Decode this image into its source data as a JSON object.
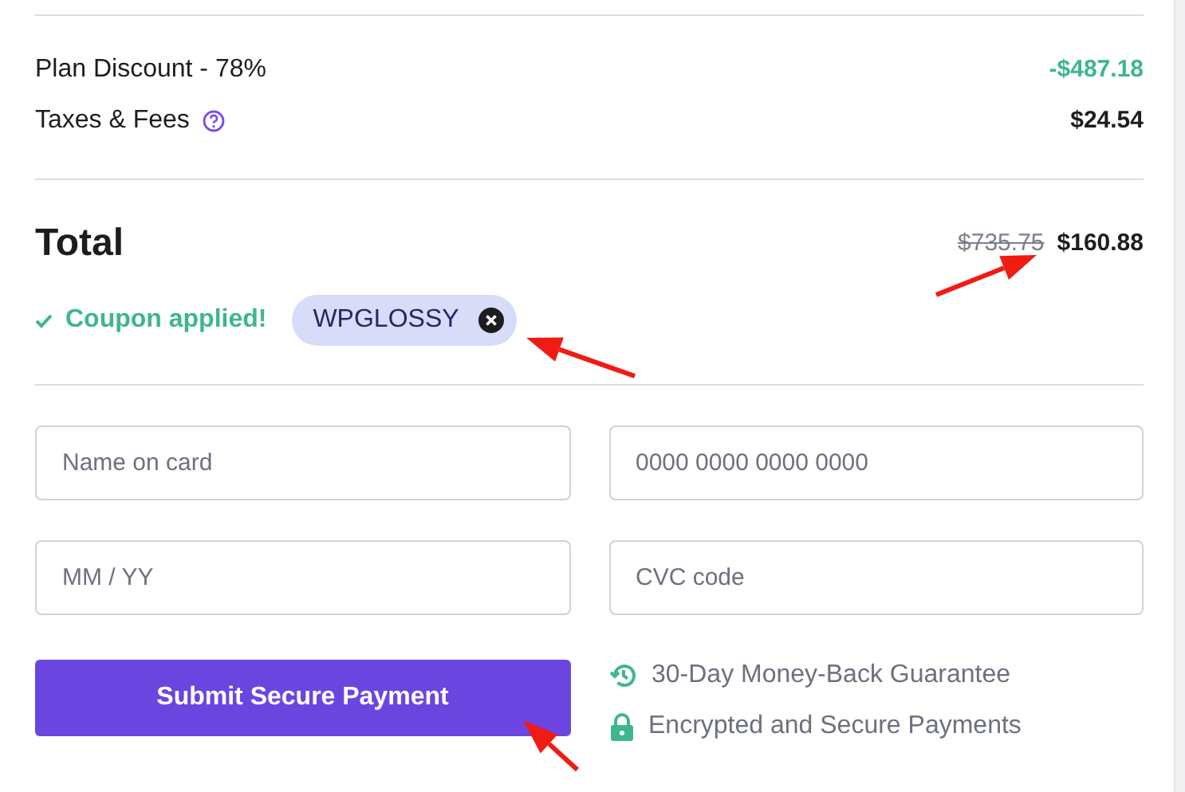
{
  "summary_rows": [
    {
      "label": "Plan Discount - 78%",
      "amount": "-$487.18",
      "kind": "discount",
      "help": false
    },
    {
      "label": "Taxes & Fees",
      "amount": "$24.54",
      "kind": "plain",
      "help": true
    }
  ],
  "total": {
    "label": "Total",
    "original": "$735.75",
    "amount": "$160.88"
  },
  "coupon": {
    "status": "Coupon applied!",
    "code": "WPGLOSSY"
  },
  "fields": [
    {
      "placeholder": "Name on card"
    },
    {
      "placeholder": "0000 0000 0000 0000"
    },
    {
      "placeholder": "MM / YY"
    },
    {
      "placeholder": "CVC code"
    }
  ],
  "submit_button": "Submit Secure Payment",
  "guarantees": [
    {
      "kind": "history",
      "text": "30-Day Money-Back Guarantee"
    },
    {
      "kind": "lock",
      "text": "Encrypted and Secure Payments"
    }
  ]
}
